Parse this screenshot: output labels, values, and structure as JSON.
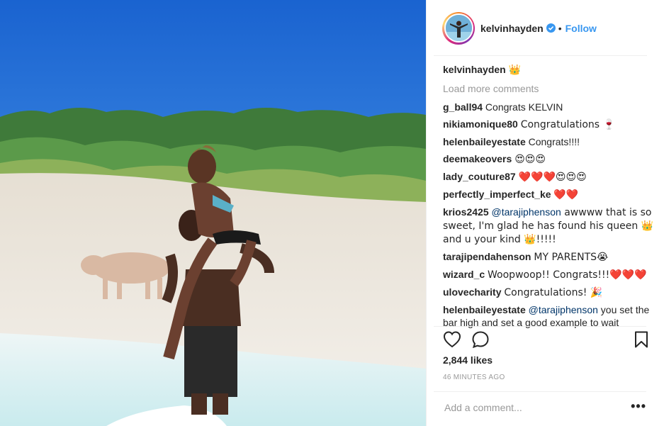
{
  "post": {
    "photo_alt": "beach photo",
    "author": "kelvinhayden",
    "follow_label": "Follow",
    "dot": "•",
    "caption_text": "",
    "caption_emoji": "👑",
    "load_more_label": "Load more comments",
    "comments": [
      {
        "user": "g_ball94",
        "text": "Congrats KELVIN"
      },
      {
        "user": "nikiamonique80",
        "text": "Congratulations 🍷"
      },
      {
        "user": "helenbaileyestate",
        "text": "Congrats!!!!"
      },
      {
        "user": "deemakeovers",
        "text": "😍😍😍"
      },
      {
        "user": "lady_couture87",
        "text": "❤️❤️❤️😍😍😍"
      },
      {
        "user": "perfectly_imperfect_ke",
        "text": "❤️❤️"
      },
      {
        "user": "krios2425",
        "mention": "@tarajiphenson",
        "text": " awwww that is so sweet, I'm glad he has found his queen 👑 and u your kind 👑!!!!!"
      },
      {
        "user": "tarajipendahenson",
        "text": "MY PARENTS😭"
      },
      {
        "user": "wizard_c",
        "text": "Woopwoop!! Congrats!!!❤️❤️❤️"
      },
      {
        "user": "ulovecharity",
        "text": "Congratulations! 🎉"
      },
      {
        "user": "helenbaileyestate",
        "mention": "@tarajiphenson",
        "text": " you set the bar high and set a good example to wait"
      }
    ],
    "likes": "2,844 likes",
    "time": "46 MINUTES AGO",
    "add_comment_placeholder": "Add a comment...",
    "more_label": "•••"
  },
  "colors": {
    "accent": "#3897f0",
    "sky": "#1f6fd6",
    "sand": "#ece6dc"
  },
  "icons": [
    "verified-badge-icon",
    "heart-icon",
    "comment-icon",
    "bookmark-icon",
    "more-options-icon"
  ]
}
